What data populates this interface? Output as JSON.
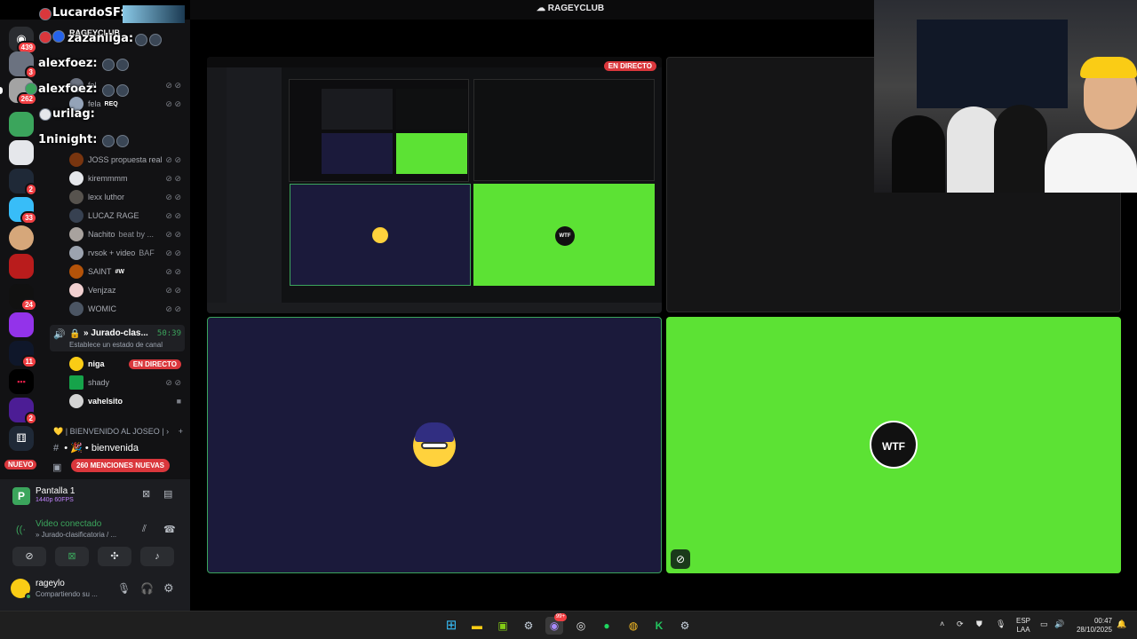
{
  "window": {
    "title": "RAGEYCLUB"
  },
  "overlay": {
    "speakers": [
      "LucardoSF:",
      "zazaniiga:",
      "alexfoez:",
      "alexfoez:",
      "urilag:",
      "1ninight:"
    ]
  },
  "rail": {
    "badges": [
      "439",
      "3",
      "262",
      "2",
      "33",
      "24",
      "11",
      "2"
    ],
    "new_label": "NUEVO"
  },
  "sidebar": {
    "server_name": "RAGEYCLUB",
    "members": [
      {
        "name": "fal",
        "color": "#6b7280"
      },
      {
        "name": "fela",
        "tag": "REQ",
        "color": "#94a3b8"
      },
      {
        "name": "JOSS propuesta real",
        "color": "#78350f"
      },
      {
        "name": "kiremmmm",
        "color": "#e5e7eb"
      },
      {
        "name": "lexx luthor",
        "color": "#57534e"
      },
      {
        "name": "LUCAZ RAGE",
        "color": "#374151"
      },
      {
        "name": "Nachito",
        "status": "beat by ...",
        "color": "#a8a29e"
      },
      {
        "name": "rvsok + video",
        "status": "BAF",
        "color": "#9ca3af"
      },
      {
        "name": "SAINT",
        "tag": "#W",
        "color": "#b45309"
      },
      {
        "name": "Venjzaz",
        "color": "#f1d0d0"
      },
      {
        "name": "WOMIC",
        "color": "#4b5563"
      }
    ],
    "voice_channel": {
      "name": "» Jurado-clas...",
      "timer": "50:39",
      "status_placeholder": "Establece un estado de canal",
      "users": [
        {
          "name": "niga",
          "live": "EN DIRECTO"
        },
        {
          "name": "shady"
        },
        {
          "name": "vahelsito"
        }
      ]
    },
    "category": "| BIENVENIDO AL JOSEO |",
    "channel": "bienvenida",
    "mentions": "260 MENCIONES NUEVAS"
  },
  "panel": {
    "stream_title": "Pantalla 1",
    "stream_quality": "1440p 60FPS",
    "voice_status": "Video conectado",
    "voice_channel": "» Jurado-clasificatoria / ...",
    "user_name": "rageylo",
    "user_status": "Compartiendo su ..."
  },
  "stream": {
    "live_badge": "EN DIRECTO",
    "logo_text": "WTF"
  },
  "taskbar": {
    "lang1": "ESP",
    "lang2": "LAA",
    "time": "00:47",
    "date": "28/10/2025",
    "discord_badge": "99+"
  },
  "colors": {
    "green_screen": "#5ce234",
    "navy_tile": "#1b1a3b",
    "discord_red": "#da373c",
    "online_green": "#3ba55c"
  }
}
